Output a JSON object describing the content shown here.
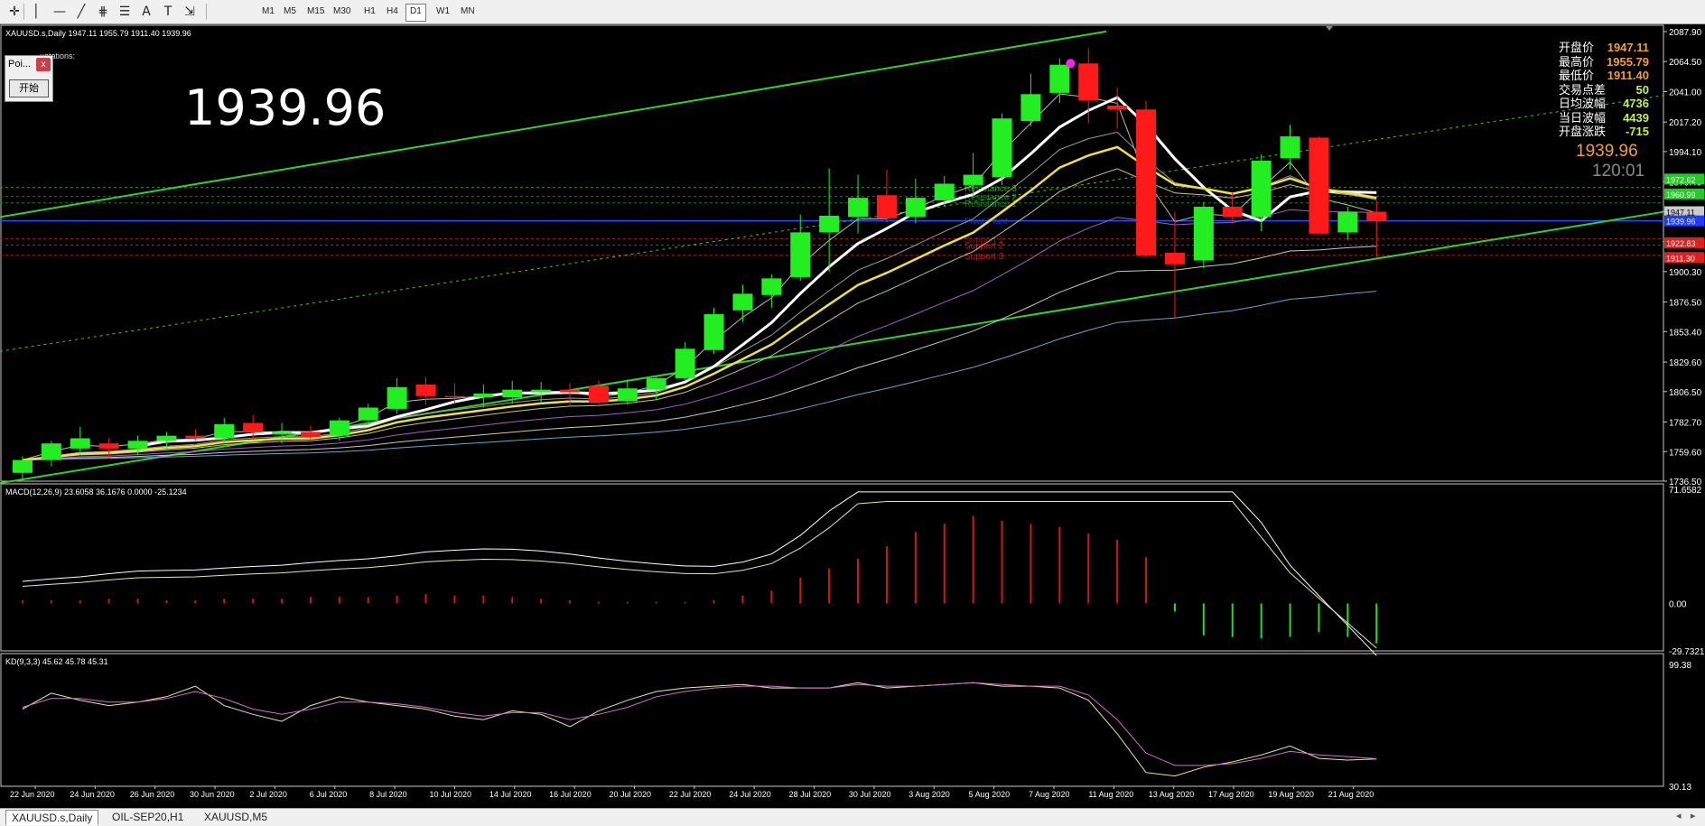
{
  "toolbar": {
    "tools": [
      {
        "name": "crosshair-icon",
        "glyph": "✛"
      },
      {
        "name": "vertical-line-icon",
        "glyph": "│"
      },
      {
        "name": "horizontal-line-icon",
        "glyph": "—"
      },
      {
        "name": "trendline-icon",
        "glyph": "╱"
      },
      {
        "name": "pitchfork-icon",
        "glyph": "⋕"
      },
      {
        "name": "fibonacci-icon",
        "glyph": "☰"
      },
      {
        "name": "text-icon",
        "glyph": "A"
      },
      {
        "name": "text-label-icon",
        "glyph": "T"
      },
      {
        "name": "arrows-icon",
        "glyph": "⇲"
      }
    ],
    "timeframes": [
      "M1",
      "M5",
      "M15",
      "M30",
      "H1",
      "H4",
      "D1",
      "W1",
      "MN"
    ],
    "active_timeframe": "D1"
  },
  "series_header": "XAUUSD.s,Daily  1947.11 1955.79 1911.40 1939.96",
  "quotes_label": "uotations:",
  "poi_panel": {
    "title": "Poi...",
    "close": "x",
    "start": "开始"
  },
  "big_price": "1939.96",
  "stats": [
    {
      "label": "开盘价",
      "value": "1947.11",
      "color": "#f0a030"
    },
    {
      "label": "最高价",
      "value": "1955.79",
      "color": "#f0a030"
    },
    {
      "label": "最低价",
      "value": "1911.40",
      "color": "#f0a030"
    },
    {
      "label": "交易点差",
      "value": "50",
      "color": "#c8f040"
    },
    {
      "label": "日均波幅",
      "value": "4736",
      "color": "#c8f040"
    },
    {
      "label": "当日波幅",
      "value": "4439",
      "color": "#c8f040"
    },
    {
      "label": "开盘涨跌",
      "value": "-715",
      "color": "#c8f040"
    }
  ],
  "stat_price": "1939.96",
  "stat_timer": "120:01",
  "levels": [
    {
      "label": "Resistance 3",
      "value": 1966,
      "color": "#1faa1f"
    },
    {
      "label": "Resistance 2",
      "value": 1959,
      "color": "#1c8c1c"
    },
    {
      "label": "Resistance 1",
      "value": 1954,
      "color": "#1c8c1c"
    },
    {
      "label": "Pivot Point",
      "value": 1940,
      "color": "#1c3cc8"
    },
    {
      "label": "Support 1",
      "value": 1926,
      "color": "#8a1c1c"
    },
    {
      "label": "Support 2",
      "value": 1921,
      "color": "#c81c1c"
    },
    {
      "label": "Support 3",
      "value": 1913,
      "color": "#c81c1c"
    }
  ],
  "axis_tags": [
    {
      "value": "1972.62",
      "price": 1972.62,
      "bg": "#22cc22"
    },
    {
      "value": "1960.99",
      "price": 1960.99,
      "bg": "#22cc22"
    },
    {
      "value": "1947.11",
      "price": 1947.11,
      "bg": "#cccccc"
    },
    {
      "value": "1939.96",
      "price": 1939.96,
      "bg": "#1e3cff"
    },
    {
      "value": "1922.83",
      "price": 1922.83,
      "bg": "#e02020"
    },
    {
      "value": "1911.30",
      "price": 1911.3,
      "bg": "#e02020"
    }
  ],
  "macd_header": "MACD(12,26,9) 23.6058 36.1676 0.0000 -25.1234",
  "kd_header": "KD(9,3,3) 45.62 45.78 45.31",
  "chart_data": [
    {
      "type": "candlestick",
      "title": "XAUUSD.s,Daily",
      "ylim": [
        1736.5,
        2087.9
      ],
      "y_ticks": [
        "2087.90",
        "2064.50",
        "2041.00",
        "2017.20",
        "1994.10",
        "1970.40",
        "1947.30",
        "1923.70",
        "1900.30",
        "1876.50",
        "1853.40",
        "1829.60",
        "1806.50",
        "1782.70",
        "1759.60",
        "1736.50"
      ],
      "x_labels": [
        "22 Jun 2020",
        "24 Jun 2020",
        "26 Jun 2020",
        "30 Jun 2020",
        "2 Jul 2020",
        "6 Jul 2020",
        "8 Jul 2020",
        "10 Jul 2020",
        "14 Jul 2020",
        "16 Jul 2020",
        "20 Jul 2020",
        "22 Jul 2020",
        "24 Jul 2020",
        "28 Jul 2020",
        "30 Jul 2020",
        "3 Aug 2020",
        "5 Aug 2020",
        "7 Aug 2020",
        "11 Aug 2020",
        "13 Aug 2020",
        "17 Aug 2020",
        "19 Aug 2020",
        "21 Aug 2020"
      ],
      "candles": [
        {
          "o": 1743,
          "h": 1756,
          "l": 1737,
          "c": 1753
        },
        {
          "o": 1753,
          "h": 1768,
          "l": 1748,
          "c": 1766
        },
        {
          "o": 1762,
          "h": 1779,
          "l": 1757,
          "c": 1770
        },
        {
          "o": 1766,
          "h": 1770,
          "l": 1754,
          "c": 1762
        },
        {
          "o": 1762,
          "h": 1772,
          "l": 1757,
          "c": 1768
        },
        {
          "o": 1768,
          "h": 1775,
          "l": 1762,
          "c": 1772
        },
        {
          "o": 1772,
          "h": 1777,
          "l": 1768,
          "c": 1770
        },
        {
          "o": 1770,
          "h": 1786,
          "l": 1766,
          "c": 1781
        },
        {
          "o": 1782,
          "h": 1788,
          "l": 1769,
          "c": 1775
        },
        {
          "o": 1773,
          "h": 1782,
          "l": 1766,
          "c": 1775
        },
        {
          "o": 1775,
          "h": 1780,
          "l": 1768,
          "c": 1771
        },
        {
          "o": 1772,
          "h": 1786,
          "l": 1768,
          "c": 1784
        },
        {
          "o": 1784,
          "h": 1797,
          "l": 1780,
          "c": 1794
        },
        {
          "o": 1793,
          "h": 1817,
          "l": 1789,
          "c": 1810
        },
        {
          "o": 1812,
          "h": 1818,
          "l": 1796,
          "c": 1803
        },
        {
          "o": 1803,
          "h": 1813,
          "l": 1797,
          "c": 1802
        },
        {
          "o": 1802,
          "h": 1812,
          "l": 1794,
          "c": 1805
        },
        {
          "o": 1802,
          "h": 1815,
          "l": 1797,
          "c": 1808
        },
        {
          "o": 1806,
          "h": 1814,
          "l": 1797,
          "c": 1808
        },
        {
          "o": 1808,
          "h": 1813,
          "l": 1796,
          "c": 1806
        },
        {
          "o": 1811,
          "h": 1815,
          "l": 1795,
          "c": 1798
        },
        {
          "o": 1799,
          "h": 1816,
          "l": 1796,
          "c": 1809
        },
        {
          "o": 1808,
          "h": 1818,
          "l": 1800,
          "c": 1817
        },
        {
          "o": 1817,
          "h": 1845,
          "l": 1815,
          "c": 1840
        },
        {
          "o": 1839,
          "h": 1872,
          "l": 1836,
          "c": 1867
        },
        {
          "o": 1870,
          "h": 1890,
          "l": 1861,
          "c": 1883
        },
        {
          "o": 1882,
          "h": 1898,
          "l": 1872,
          "c": 1895
        },
        {
          "o": 1896,
          "h": 1945,
          "l": 1893,
          "c": 1931
        },
        {
          "o": 1931,
          "h": 1981,
          "l": 1900,
          "c": 1944
        },
        {
          "o": 1943,
          "h": 1976,
          "l": 1930,
          "c": 1958
        },
        {
          "o": 1960,
          "h": 1980,
          "l": 1939,
          "c": 1942
        },
        {
          "o": 1943,
          "h": 1973,
          "l": 1938,
          "c": 1958
        },
        {
          "o": 1956,
          "h": 1975,
          "l": 1951,
          "c": 1969
        },
        {
          "o": 1968,
          "h": 1993,
          "l": 1958,
          "c": 1976
        },
        {
          "o": 1974,
          "h": 2024,
          "l": 1968,
          "c": 2020
        },
        {
          "o": 2018,
          "h": 2055,
          "l": 2014,
          "c": 2039
        },
        {
          "o": 2040,
          "h": 2067,
          "l": 2032,
          "c": 2062
        },
        {
          "o": 2063,
          "h": 2075,
          "l": 2016,
          "c": 2034
        },
        {
          "o": 2030,
          "h": 2044,
          "l": 2012,
          "c": 2027
        },
        {
          "o": 2027,
          "h": 2034,
          "l": 1911,
          "c": 1913
        },
        {
          "o": 1915,
          "h": 1947,
          "l": 1863,
          "c": 1906
        },
        {
          "o": 1909,
          "h": 1955,
          "l": 1903,
          "c": 1951
        },
        {
          "o": 1951,
          "h": 1962,
          "l": 1938,
          "c": 1943
        },
        {
          "o": 1943,
          "h": 1992,
          "l": 1932,
          "c": 1987
        },
        {
          "o": 1989,
          "h": 2015,
          "l": 1980,
          "c": 2006
        },
        {
          "o": 2005,
          "h": 2006,
          "l": 1930,
          "c": 1930
        },
        {
          "o": 1931,
          "h": 1951,
          "l": 1925,
          "c": 1947
        },
        {
          "o": 1947.11,
          "h": 1955.79,
          "l": 1911.4,
          "c": 1939.96
        }
      ]
    },
    {
      "type": "bar",
      "title": "MACD(12,26,9)",
      "ylim": [
        -29.7321,
        71.6582
      ],
      "y_ticks": [
        "71.6582",
        "0.00",
        "-29.7321"
      ],
      "values": [
        2,
        2,
        2,
        3,
        3,
        2,
        2,
        3,
        3,
        3,
        4,
        4,
        4,
        5,
        6,
        5,
        5,
        4,
        3,
        2,
        1,
        1,
        1,
        1,
        2,
        5,
        8,
        16,
        22,
        28,
        36,
        45,
        50,
        55,
        52,
        50,
        48,
        44,
        40,
        29,
        -5,
        -20,
        -21,
        -22,
        -21,
        -18,
        -21,
        -25
      ]
    },
    {
      "type": "line",
      "title": "KD(9,3,3)",
      "ylim": [
        30.13,
        99.38
      ],
      "y_ticks": [
        "99.38",
        "30.13"
      ],
      "series": [
        {
          "values": [
            74,
            83,
            79,
            76,
            78,
            81,
            87,
            76,
            71,
            67,
            76,
            81,
            78,
            76,
            74,
            70,
            68,
            73,
            71,
            64,
            73,
            79,
            84,
            86,
            87,
            88,
            86,
            86,
            86,
            89,
            86,
            87,
            88,
            89,
            87,
            87,
            86,
            79,
            60,
            38,
            36,
            41,
            44,
            48,
            53,
            46,
            45,
            45.62
          ]
        },
        {
          "values": [
            75,
            80,
            80,
            78,
            78,
            80,
            84,
            80,
            74,
            71,
            74,
            78,
            78,
            77,
            75,
            72,
            70,
            72,
            72,
            68,
            71,
            75,
            81,
            84,
            86,
            87,
            87,
            86,
            86,
            88,
            87,
            87,
            88,
            89,
            88,
            87,
            87,
            82,
            68,
            49,
            42,
            42,
            43,
            46,
            50,
            48,
            47,
            45.78
          ]
        }
      ]
    }
  ],
  "tabs": [
    "XAUUSD.s,Daily",
    "OIL-SEP20,H1",
    "XAUUSD,M5"
  ],
  "active_tab": "XAUUSD.s,Daily"
}
